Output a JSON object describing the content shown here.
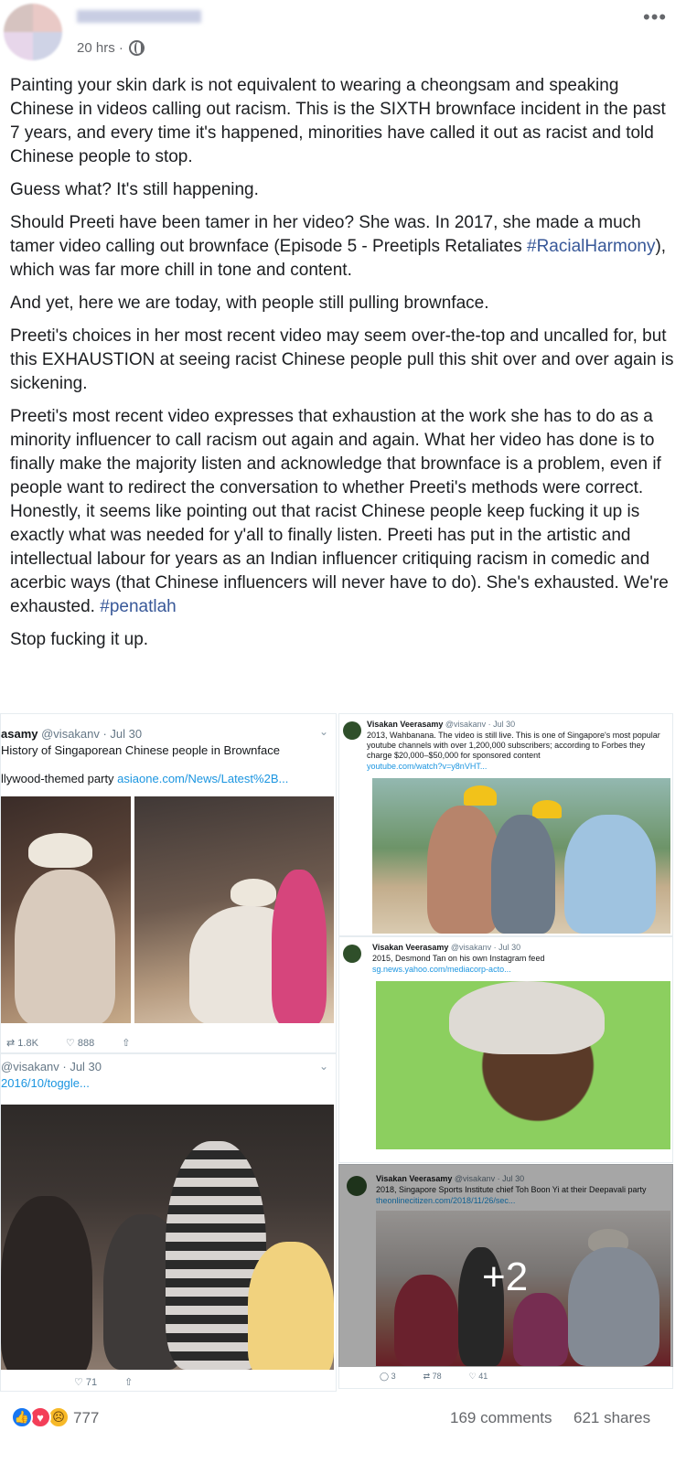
{
  "post": {
    "timestamp": "20 hrs ·",
    "paragraphs": [
      "Painting your skin dark is not equivalent to wearing a cheongsam and speaking Chinese in videos calling out racism. This is the SIXTH brownface incident in the past 7 years, and every time it's happened, minorities have called it out as racist and told Chinese people to stop.",
      "Guess what? It's still happening.",
      "Should Preeti have been tamer in her video? She was. In 2017, she made a much tamer video calling out brownface (Episode 5 - Preetipls Retaliates ",
      "And yet, here we are today, with people still pulling brownface.",
      "Preeti's choices in her most recent video may seem over-the-top and uncalled for, but this EXHAUSTION at seeing racist Chinese people pull this shit over and over again is sickening.",
      "Preeti's most recent video expresses that exhaustion at the work she has to do as a minority influencer to call racism out again and again. What her video has done is to finally make the majority listen and acknowledge that brownface is a problem, even if people want to redirect the conversation to whether Preeti's methods were correct. Honestly, it seems like pointing out that racist Chinese people keep fucking it up is exactly what was needed for y'all to finally listen. Preeti has put in the artistic and intellectual labour for years as an Indian influencer critiquing racism in comedic and acerbic ways (that Chinese influencers will never have to do). She's exhausted. We're exhausted. ",
      "Stop fucking it up."
    ],
    "p3_hashtag": "#RacialHarmony",
    "p3_tail": "), which was far more chill in tone and content.",
    "p6_hashtag": "#penatlah"
  },
  "media": {
    "tweet1": {
      "name": "asamy",
      "handle_date": "@visakanv · Jul 30",
      "text": "History of Singaporean Chinese people in Brownface",
      "line2": "llywood-themed party ",
      "link": "asiaone.com/News/Latest%2B...",
      "retweets": "1.8K",
      "likes": "888"
    },
    "tweet2": {
      "handle_date": "@visakanv · Jul 30",
      "link": "2016/10/toggle...",
      "likes": "71"
    },
    "tweet3": {
      "name": "Visakan Veerasamy",
      "handle_date": "@visakanv · Jul 30",
      "text": "2013, Wahbanana. The video is still live. This is one of Singapore's most popular youtube channels with over 1,200,000 subscribers; according to Forbes they charge $20,000–$50,000 for sponsored content",
      "link": "youtube.com/watch?v=y8nVHT..."
    },
    "tweet4": {
      "name": "Visakan Veerasamy",
      "handle_date": "@visakanv · Jul 30",
      "text": "2015, Desmond Tan on his own Instagram feed",
      "link": "sg.news.yahoo.com/mediacorp-acto..."
    },
    "tweet5": {
      "name": "Visakan Veerasamy",
      "handle_date": "@visakanv · Jul 30",
      "text": "2018, Singapore Sports Institute chief Toh Boon Yi at their Deepavali party",
      "link": "theonlinecitizen.com/2018/11/26/sec...",
      "replies": "3",
      "retweets": "78",
      "likes": "41"
    },
    "more_count": "+2"
  },
  "footer": {
    "reactions": "777",
    "comments": "169 comments",
    "shares": "621 shares"
  },
  "icons": [
    "globe-icon",
    "more-options-icon",
    "like-icon",
    "love-icon",
    "sad-icon",
    "retweet-icon",
    "heart-icon",
    "share-icon",
    "chevron-down-icon"
  ],
  "colors": {
    "hashtag": "#385898",
    "link": "#1b95e0",
    "like": "#1877f2",
    "love": "#f33e58",
    "sad": "#f7b928"
  }
}
